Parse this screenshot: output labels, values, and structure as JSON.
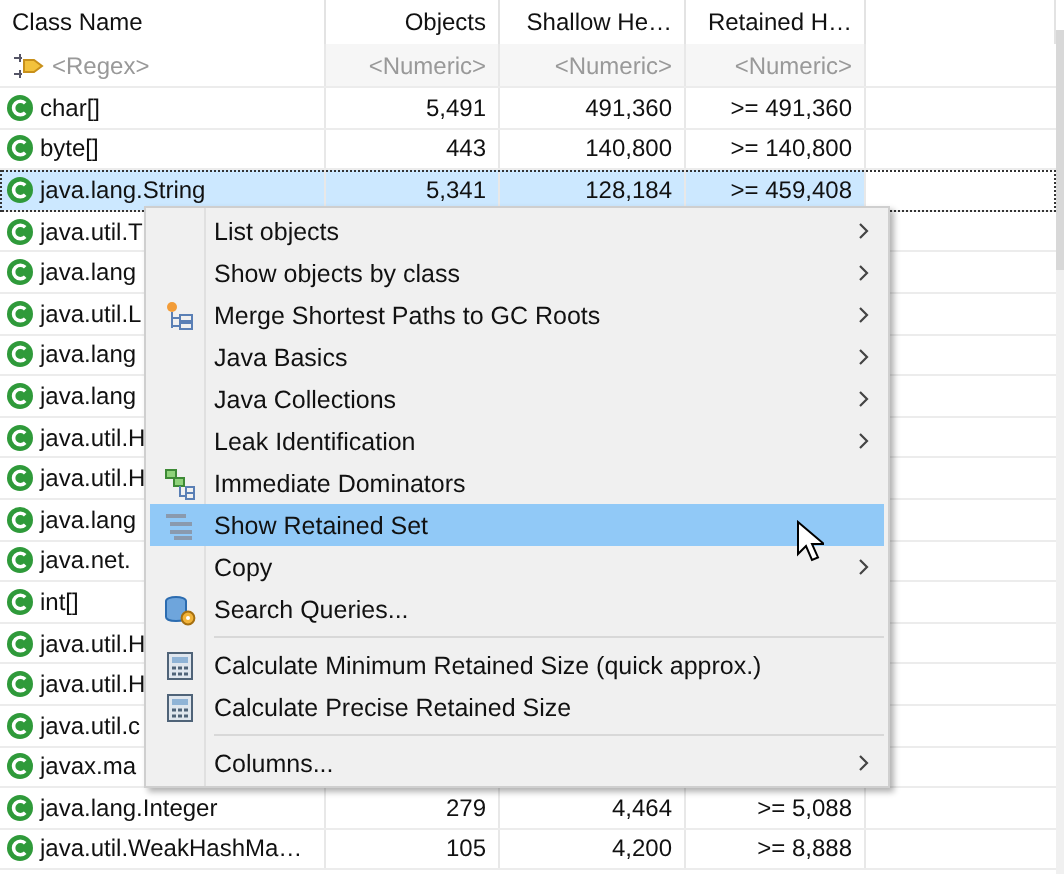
{
  "table": {
    "columns": [
      "Class Name",
      "Objects",
      "Shallow He…",
      "Retained H…"
    ],
    "filters": [
      "<Regex>",
      "<Numeric>",
      "<Numeric>",
      "<Numeric>"
    ],
    "rows": [
      {
        "cells": [
          "char[]",
          "5,491",
          "491,360",
          ">= 491,360"
        ],
        "selected": false
      },
      {
        "cells": [
          "byte[]",
          "443",
          "140,800",
          ">= 140,800"
        ],
        "selected": false
      },
      {
        "cells": [
          "java.lang.String",
          "5,341",
          "128,184",
          ">= 459,408"
        ],
        "selected": true
      },
      {
        "cells": [
          "java.util.T"
        ],
        "selected": false
      },
      {
        "cells": [
          "java.lang"
        ],
        "selected": false
      },
      {
        "cells": [
          "java.util.L"
        ],
        "selected": false
      },
      {
        "cells": [
          "java.lang"
        ],
        "selected": false
      },
      {
        "cells": [
          "java.lang"
        ],
        "selected": false
      },
      {
        "cells": [
          "java.util.H"
        ],
        "selected": false
      },
      {
        "cells": [
          "java.util.H"
        ],
        "selected": false
      },
      {
        "cells": [
          "java.lang"
        ],
        "selected": false
      },
      {
        "cells": [
          "java.net."
        ],
        "selected": false
      },
      {
        "cells": [
          "int[]"
        ],
        "selected": false
      },
      {
        "cells": [
          "java.util.H"
        ],
        "selected": false
      },
      {
        "cells": [
          "java.util.H"
        ],
        "selected": false
      },
      {
        "cells": [
          "java.util.c"
        ],
        "selected": false
      },
      {
        "cells": [
          "javax.ma"
        ],
        "selected": false
      },
      {
        "cells": [
          "java.lang.Integer",
          "279",
          "4,464",
          ">= 5,088"
        ],
        "selected": false
      },
      {
        "cells": [
          "java.util.WeakHashMa…",
          "105",
          "4,200",
          ">= 8,888"
        ],
        "selected": false
      }
    ]
  },
  "context_menu": {
    "items": [
      {
        "kind": "item",
        "label": "List objects",
        "submenu": true,
        "selected": false
      },
      {
        "kind": "item",
        "label": "Show objects by class",
        "submenu": true,
        "selected": false
      },
      {
        "kind": "item",
        "label": "Merge Shortest Paths to GC Roots",
        "submenu": true,
        "selected": false
      },
      {
        "kind": "item",
        "label": "Java Basics",
        "submenu": true,
        "selected": false
      },
      {
        "kind": "item",
        "label": "Java Collections",
        "submenu": true,
        "selected": false
      },
      {
        "kind": "item",
        "label": "Leak Identification",
        "submenu": true,
        "selected": false
      },
      {
        "kind": "item",
        "label": "Immediate Dominators",
        "submenu": false,
        "selected": false
      },
      {
        "kind": "item",
        "label": "Show Retained Set",
        "submenu": false,
        "selected": true
      },
      {
        "kind": "item",
        "label": "Copy",
        "submenu": true,
        "selected": false
      },
      {
        "kind": "item",
        "label": "Search Queries...",
        "submenu": false,
        "selected": false
      },
      {
        "kind": "separator"
      },
      {
        "kind": "item",
        "label": "Calculate Minimum Retained Size (quick approx.)",
        "submenu": false,
        "selected": false
      },
      {
        "kind": "item",
        "label": "Calculate Precise Retained Size",
        "submenu": false,
        "selected": false
      },
      {
        "kind": "separator"
      },
      {
        "kind": "item",
        "label": "Columns...",
        "submenu": true,
        "selected": false
      }
    ]
  }
}
